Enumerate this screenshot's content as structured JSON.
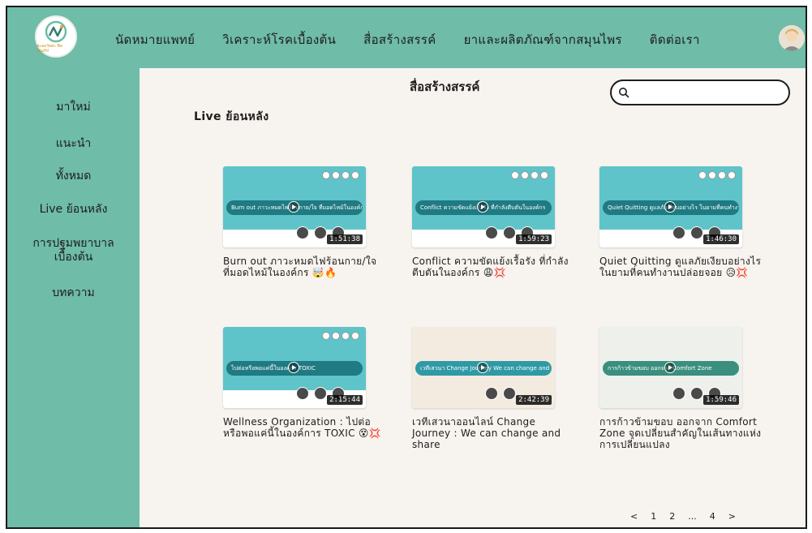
{
  "logo": {
    "tagline": "ชะลอวัยค่ะ Be Youth!",
    "color": "#6fbca8"
  },
  "nav": {
    "items": [
      {
        "label": "นัดหมายแพทย์"
      },
      {
        "label": "วิเคราะห์โรคเบื้องต้น"
      },
      {
        "label": "สื่อสร้างสรรค์"
      },
      {
        "label": "ยาและผลิตภัณฑ์จากสมุนไพร"
      },
      {
        "label": "ติดต่อเรา"
      }
    ]
  },
  "sidebar": {
    "items": [
      {
        "label": "มาใหม่"
      },
      {
        "label": "แนะนำ"
      },
      {
        "label": "ทั้งหมด"
      },
      {
        "label": "Live ย้อนหลัง"
      },
      {
        "label": "การปฐมพยาบาลเบื้องต้น"
      },
      {
        "label": "บทความ"
      }
    ]
  },
  "main": {
    "page_title": "สื่อสร้างสรรค์",
    "section_title": "Live ย้อนหลัง",
    "search": {
      "value": "",
      "placeholder": "",
      "icon": "search-icon"
    }
  },
  "videos": [
    {
      "title": "Burn out ภาวะหมดไฟร้อนกาย/ใจ ที่มอดไหม้ในองค์กร 🤯🔥",
      "duration": "1:51:38",
      "thumb_text": "Burn out ภาวะหมดไฟร้อนกาย/ใจ ที่มอดไหม้ในองค์กร",
      "theme": "#5ec4c9"
    },
    {
      "title": "Conflict ความขัดแย้งเรื้อรัง ที่กำลังตีบตันในองค์กร 😩💢",
      "duration": "1:59:23",
      "thumb_text": "Conflict ความขัดแย้งเรื้อรัง ที่กำลังตีบตันในองค์กร",
      "theme": "#5ec4c9"
    },
    {
      "title": "Quiet Quitting ดูแลภัยเงียบอย่างไร ในยามที่คนทำงานปล่อยจอย 😥💢",
      "duration": "1:46:30",
      "thumb_text": "Quiet Quitting ดูแลภัยเงียบอย่างไร ในยามที่คนทำงานปล่อยจอย",
      "theme": "#5ec4c9"
    },
    {
      "title": "Wellness Organization : ไปต่อหรือพอแค่นี้ในองค์การ TOXIC 😵💢",
      "duration": "2:15:44",
      "thumb_text": "ไปต่อหรือพอแค่นี้ในองค์กร TOXIC",
      "theme": "#5ec4c9"
    },
    {
      "title": "เวทีเสวนาออนไลน์ Change Journey : We can change and share",
      "duration": "2:42:39",
      "thumb_text": "เวทีเสวนา Change Journey We can change and share",
      "theme": "#f3ebe0"
    },
    {
      "title": "การก้าวข้ามขอบ ออกจาก Comfort Zone จุดเปลี่ยนสำคัญในเส้นทางแห่งการเปลี่ยนแปลง",
      "duration": "1:59:46",
      "thumb_text": "การก้าวข้ามขอบ ออกจาก Comfort Zone",
      "theme": "#eef0ec"
    }
  ],
  "pagination": {
    "prev": "<",
    "pages": [
      "1",
      "2",
      "...",
      "4"
    ],
    "next": ">"
  },
  "colors": {
    "teal": "#6fbca8",
    "background": "#f7f3ee",
    "text": "#1d1d1d"
  }
}
